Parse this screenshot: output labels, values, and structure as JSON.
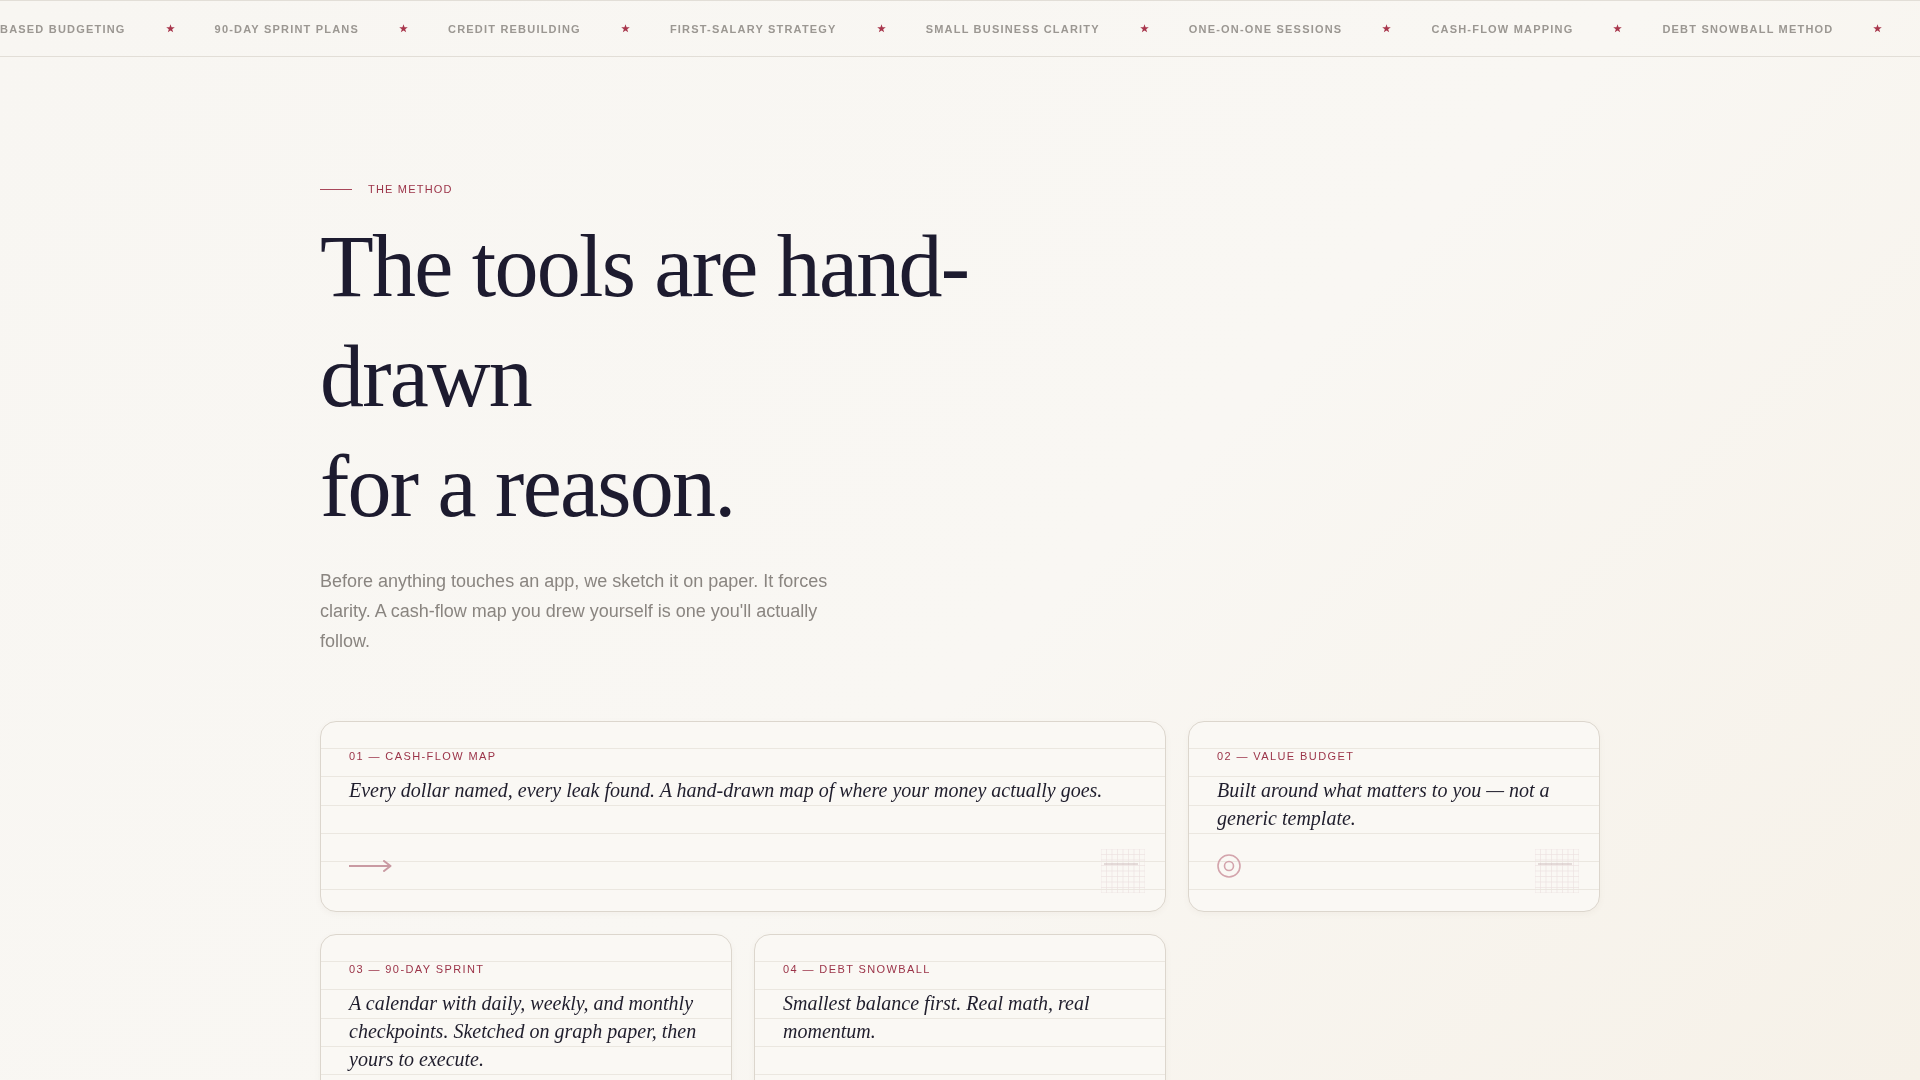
{
  "ticker": [
    "BASED BUDGETING",
    "90-DAY SPRINT PLANS",
    "CREDIT REBUILDING",
    "FIRST-SALARY STRATEGY",
    "SMALL BUSINESS CLARITY",
    "ONE-ON-ONE SESSIONS",
    "CASH-FLOW MAPPING",
    "DEBT SNOWBALL METHOD"
  ],
  "section": {
    "eyebrow": "THE METHOD",
    "heading_lines": [
      "The tools are hand-drawn",
      "for a reason."
    ],
    "intro": "Before anything touches an app, we sketch it on paper. It forces clarity. A cash-flow map you drew yourself is one you'll actually follow."
  },
  "cards": [
    {
      "label": "01 — CASH-FLOW MAP",
      "text": "Every dollar named, every leak found. A hand-drawn map of where your money actually goes."
    },
    {
      "label": "02 — VALUE BUDGET",
      "text": "Built around what matters to you — not a generic template."
    },
    {
      "label": "03 — 90-DAY SPRINT",
      "text": "A calendar with daily, weekly, and monthly checkpoints. Sketched on graph paper, then yours to execute."
    },
    {
      "label": "04 — DEBT SNOWBALL",
      "text": "Smallest balance first. Real math, real momentum."
    }
  ]
}
